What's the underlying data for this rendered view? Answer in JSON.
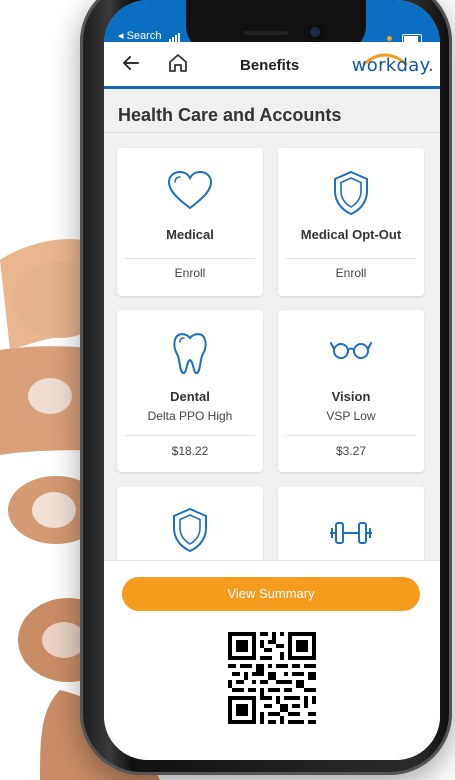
{
  "status_bar": {
    "carrier": "Search"
  },
  "nav": {
    "title": "Benefits",
    "logo_text": "workday."
  },
  "section": {
    "title": "Health Care and Accounts"
  },
  "cards": [
    {
      "title": "Medical",
      "subtitle": "",
      "footer": "Enroll",
      "icon": "heart-icon"
    },
    {
      "title": "Medical Opt-Out",
      "subtitle": "",
      "footer": "Enroll",
      "icon": "shield-icon"
    },
    {
      "title": "Dental",
      "subtitle": "Delta PPO High",
      "footer": "$18.22",
      "icon": "tooth-icon"
    },
    {
      "title": "Vision",
      "subtitle": "VSP Low",
      "footer": "$3.27",
      "icon": "glasses-icon"
    },
    {
      "title": "",
      "subtitle": "",
      "footer": "",
      "icon": "shield-icon"
    },
    {
      "title": "",
      "subtitle": "",
      "footer": "",
      "icon": "dumbbell-icon"
    }
  ],
  "bottom": {
    "button_label": "View Summary"
  },
  "colors": {
    "accent_blue": "#0c5aa6",
    "button_orange": "#f59b1d",
    "icon_blue": "#1c6fc2"
  }
}
